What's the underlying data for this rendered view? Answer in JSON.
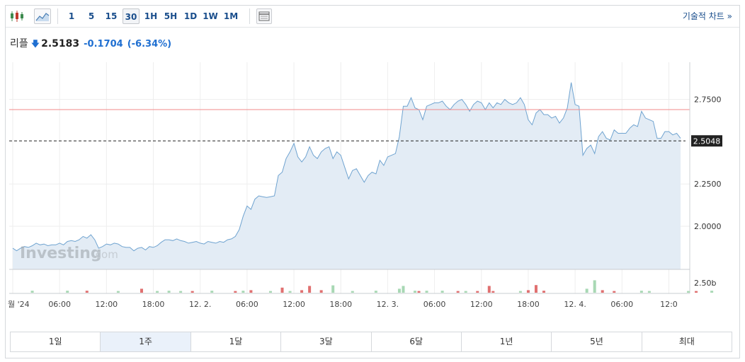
{
  "toolbar": {
    "intervals": [
      {
        "label": "1",
        "active": false
      },
      {
        "label": "5",
        "active": false
      },
      {
        "label": "15",
        "active": false
      },
      {
        "label": "30",
        "active": true
      },
      {
        "label": "1H",
        "active": false
      },
      {
        "label": "5H",
        "active": false
      },
      {
        "label": "1D",
        "active": false
      },
      {
        "label": "1W",
        "active": false
      },
      {
        "label": "1M",
        "active": false
      }
    ],
    "tech_chart_link": "기술적 차트 »"
  },
  "quote": {
    "name": "리플",
    "price": "2.5183",
    "change": "-0.1704",
    "change_pct": "(-6.34%)"
  },
  "watermark": {
    "brand": "Investing",
    "suffix": ".com"
  },
  "chart_data": {
    "type": "area",
    "y_ticks": [
      "2.7500",
      "2.2500",
      "2.0000"
    ],
    "y_tick_values": [
      2.75,
      2.25,
      2.0
    ],
    "ylim": [
      1.745,
      2.97
    ],
    "current_value_label": "2.5048",
    "current_value": 2.5048,
    "reference_value": 2.69,
    "x_tick_labels": [
      "월 '24",
      "06:00",
      "12:00",
      "18:00",
      "12. 2.",
      "06:00",
      "12:00",
      "18:00",
      "12. 3.",
      "06:00",
      "12:00",
      "18:00",
      "12. 4.",
      "06:00",
      "12:0"
    ],
    "x_tick_index": [
      0,
      12,
      24,
      36,
      48,
      60,
      72,
      84,
      96,
      108,
      120,
      132,
      144,
      156,
      168
    ],
    "values": [
      1.87,
      1.855,
      1.87,
      1.88,
      1.875,
      1.885,
      1.9,
      1.89,
      1.895,
      1.885,
      1.89,
      1.89,
      1.9,
      1.89,
      1.91,
      1.915,
      1.91,
      1.92,
      1.94,
      1.93,
      1.95,
      1.92,
      1.87,
      1.88,
      1.895,
      1.89,
      1.9,
      1.895,
      1.88,
      1.875,
      1.875,
      1.855,
      1.87,
      1.875,
      1.86,
      1.88,
      1.875,
      1.885,
      1.905,
      1.92,
      1.92,
      1.915,
      1.925,
      1.915,
      1.91,
      1.9,
      1.905,
      1.91,
      1.9,
      1.895,
      1.91,
      1.905,
      1.9,
      1.91,
      1.905,
      1.92,
      1.925,
      1.94,
      1.98,
      2.06,
      2.12,
      2.1,
      2.16,
      2.18,
      2.175,
      2.17,
      2.175,
      2.18,
      2.3,
      2.32,
      2.4,
      2.44,
      2.49,
      2.41,
      2.38,
      2.41,
      2.47,
      2.42,
      2.4,
      2.44,
      2.46,
      2.47,
      2.4,
      2.44,
      2.42,
      2.35,
      2.28,
      2.33,
      2.34,
      2.3,
      2.26,
      2.3,
      2.32,
      2.31,
      2.39,
      2.36,
      2.41,
      2.42,
      2.43,
      2.53,
      2.71,
      2.71,
      2.76,
      2.7,
      2.69,
      2.63,
      2.71,
      2.72,
      2.73,
      2.73,
      2.74,
      2.71,
      2.69,
      2.72,
      2.74,
      2.75,
      2.72,
      2.68,
      2.72,
      2.74,
      2.73,
      2.69,
      2.73,
      2.7,
      2.73,
      2.72,
      2.75,
      2.73,
      2.72,
      2.73,
      2.76,
      2.72,
      2.63,
      2.6,
      2.67,
      2.69,
      2.66,
      2.66,
      2.64,
      2.65,
      2.61,
      2.64,
      2.7,
      2.85,
      2.72,
      2.71,
      2.42,
      2.46,
      2.48,
      2.43,
      2.53,
      2.56,
      2.52,
      2.51,
      2.57,
      2.55,
      2.55,
      2.55,
      2.58,
      2.6,
      2.59,
      2.68,
      2.64,
      2.63,
      2.62,
      2.52,
      2.52,
      2.56,
      2.56,
      2.54,
      2.55,
      2.52
    ],
    "volume": {
      "tick_label": "2.50b",
      "tick_value": 2.5,
      "bars": [
        {
          "i": 5,
          "v": 0.35,
          "dir": "up"
        },
        {
          "i": 14,
          "v": 0.35,
          "dir": "up"
        },
        {
          "i": 19,
          "v": 0.35,
          "dir": "down"
        },
        {
          "i": 27,
          "v": 0.3,
          "dir": "up"
        },
        {
          "i": 33,
          "v": 0.7,
          "dir": "down"
        },
        {
          "i": 37,
          "v": 0.3,
          "dir": "up"
        },
        {
          "i": 40,
          "v": 0.35,
          "dir": "up"
        },
        {
          "i": 43,
          "v": 0.3,
          "dir": "up"
        },
        {
          "i": 46,
          "v": 0.3,
          "dir": "down"
        },
        {
          "i": 51,
          "v": 0.35,
          "dir": "up"
        },
        {
          "i": 57,
          "v": 0.3,
          "dir": "down"
        },
        {
          "i": 59,
          "v": 0.35,
          "dir": "up"
        },
        {
          "i": 61,
          "v": 0.45,
          "dir": "down"
        },
        {
          "i": 66,
          "v": 0.3,
          "dir": "up"
        },
        {
          "i": 69,
          "v": 0.9,
          "dir": "down"
        },
        {
          "i": 71,
          "v": 0.3,
          "dir": "up"
        },
        {
          "i": 74,
          "v": 0.45,
          "dir": "down"
        },
        {
          "i": 76,
          "v": 1.2,
          "dir": "down"
        },
        {
          "i": 79,
          "v": 0.45,
          "dir": "down"
        },
        {
          "i": 82,
          "v": 1.3,
          "dir": "up"
        },
        {
          "i": 87,
          "v": 0.3,
          "dir": "up"
        },
        {
          "i": 93,
          "v": 0.35,
          "dir": "up"
        },
        {
          "i": 99,
          "v": 0.7,
          "dir": "up"
        },
        {
          "i": 100,
          "v": 1.2,
          "dir": "up"
        },
        {
          "i": 103,
          "v": 0.35,
          "dir": "up"
        },
        {
          "i": 104,
          "v": 0.3,
          "dir": "down"
        },
        {
          "i": 106,
          "v": 0.35,
          "dir": "up"
        },
        {
          "i": 110,
          "v": 0.35,
          "dir": "up"
        },
        {
          "i": 114,
          "v": 0.3,
          "dir": "down"
        },
        {
          "i": 116,
          "v": 0.3,
          "dir": "up"
        },
        {
          "i": 119,
          "v": 0.3,
          "dir": "down"
        },
        {
          "i": 122,
          "v": 1.2,
          "dir": "down"
        },
        {
          "i": 123,
          "v": 0.3,
          "dir": "down"
        },
        {
          "i": 130,
          "v": 0.3,
          "dir": "up"
        },
        {
          "i": 132,
          "v": 0.45,
          "dir": "down"
        },
        {
          "i": 134,
          "v": 1.35,
          "dir": "down"
        },
        {
          "i": 136,
          "v": 0.35,
          "dir": "down"
        },
        {
          "i": 147,
          "v": 0.7,
          "dir": "up"
        },
        {
          "i": 149,
          "v": 2.2,
          "dir": "up"
        },
        {
          "i": 151,
          "v": 0.45,
          "dir": "down"
        },
        {
          "i": 154,
          "v": 0.3,
          "dir": "down"
        },
        {
          "i": 161,
          "v": 0.35,
          "dir": "up"
        },
        {
          "i": 163,
          "v": 0.3,
          "dir": "up"
        },
        {
          "i": 173,
          "v": 0.3,
          "dir": "up"
        },
        {
          "i": 175,
          "v": 0.3,
          "dir": "down"
        },
        {
          "i": 179,
          "v": 0.35,
          "dir": "up"
        }
      ]
    },
    "colors": {
      "line": "#6fa3d0",
      "area": "#e3ecf5",
      "reference": "#f08a8a",
      "up": "#a8d8b4",
      "down": "#e07070",
      "grid": "#eeeeee"
    },
    "grid": true
  },
  "ranges": [
    {
      "label": "1일",
      "active": false
    },
    {
      "label": "1주",
      "active": true
    },
    {
      "label": "1달",
      "active": false
    },
    {
      "label": "3달",
      "active": false
    },
    {
      "label": "6달",
      "active": false
    },
    {
      "label": "1년",
      "active": false
    },
    {
      "label": "5년",
      "active": false
    },
    {
      "label": "최대",
      "active": false
    }
  ]
}
